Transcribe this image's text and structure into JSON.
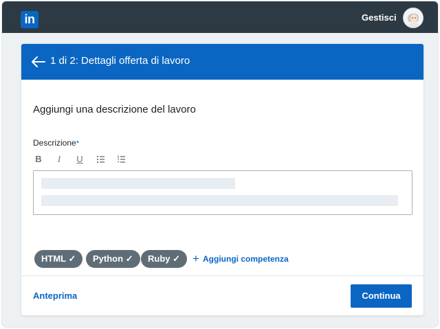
{
  "topbar": {
    "logo_text": "in",
    "manage_label": "Gestisci",
    "avatar_icon": "user-avatar"
  },
  "header": {
    "title": "1 di 2: Dettagli offerta di lavoro",
    "back_icon": "arrow-left-icon"
  },
  "main": {
    "section_title": "Aggiungi una descrizione del lavoro",
    "description_label": "Descrizione",
    "required_marker": "*",
    "toolbar": [
      {
        "name": "bold",
        "glyph": "B"
      },
      {
        "name": "italic",
        "glyph": "I"
      },
      {
        "name": "underline",
        "glyph": "U"
      },
      {
        "name": "bullet-list",
        "glyph": "list"
      },
      {
        "name": "numbered-list",
        "glyph": "numlist"
      }
    ]
  },
  "skills": {
    "items": [
      "HTML",
      "Python",
      "Ruby"
    ],
    "check_glyph": "✓",
    "add_label": "Aggiungi competenza",
    "add_glyph": "+"
  },
  "footer": {
    "preview_label": "Anteprima",
    "continue_label": "Continua"
  },
  "colors": {
    "topbar": "#2d3a43",
    "brand_blue": "#0a66c2",
    "chip": "#5f6d77",
    "page_bg": "#eef1f3"
  }
}
